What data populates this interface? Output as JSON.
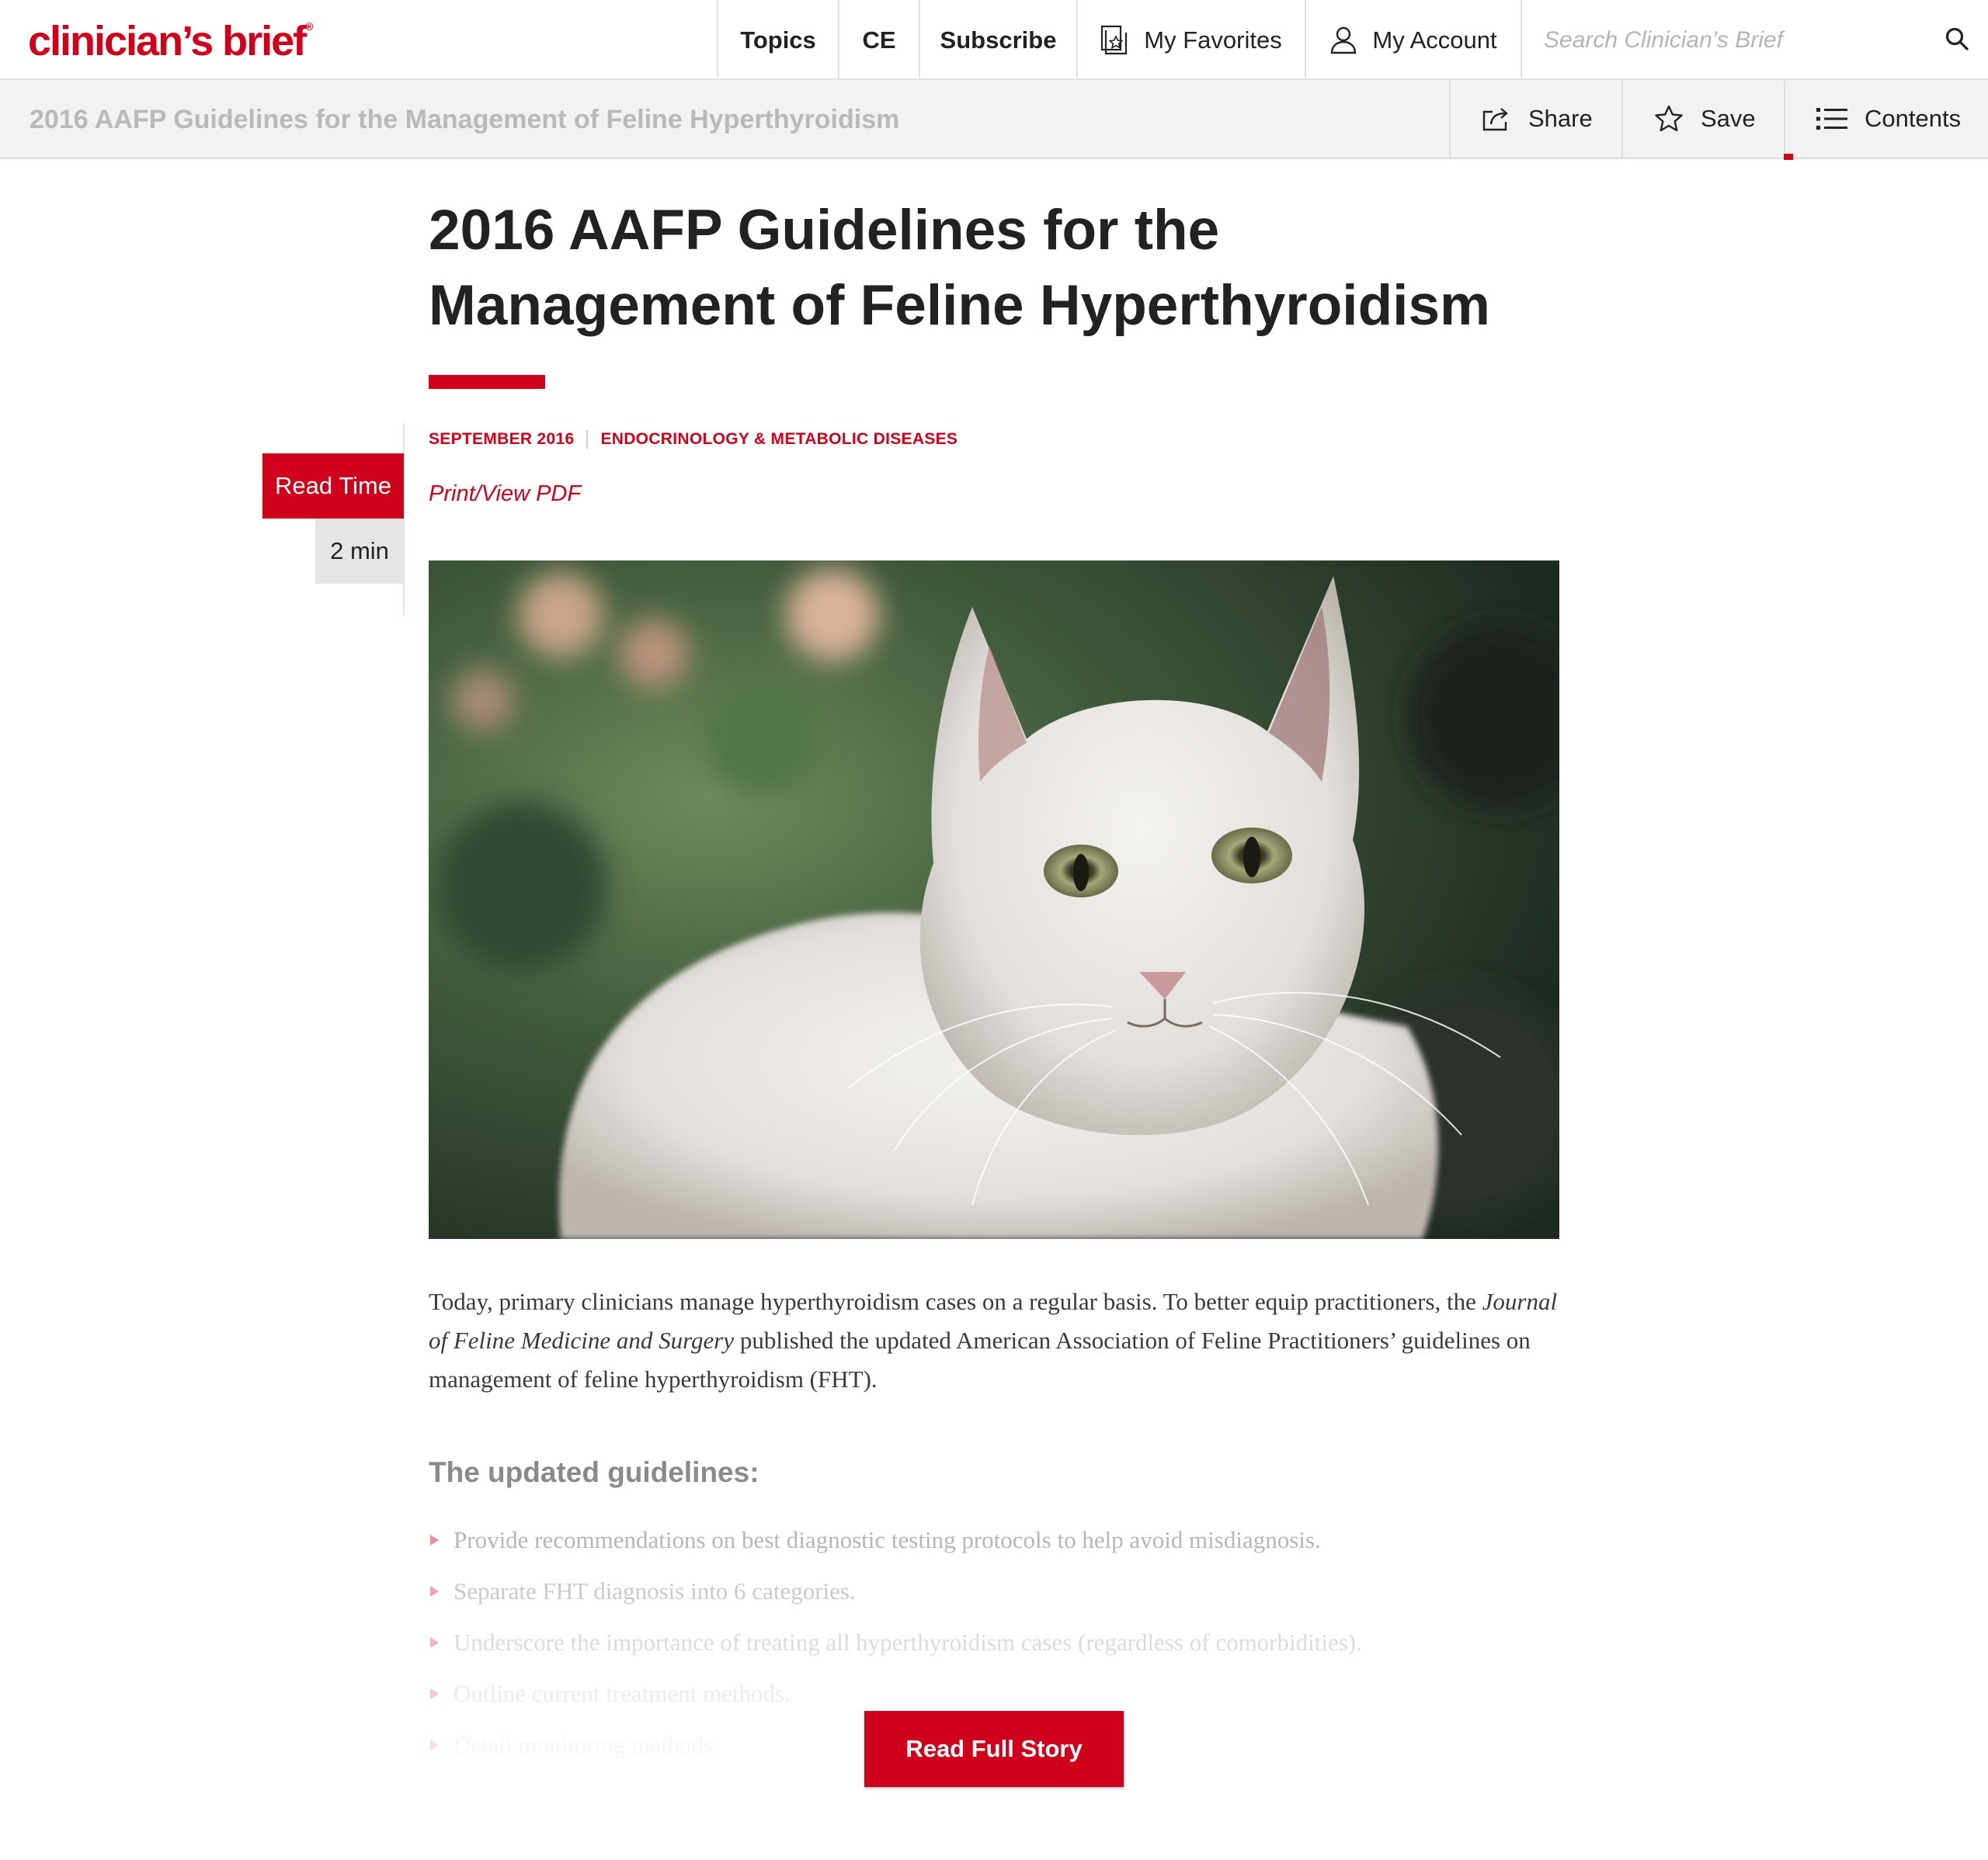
{
  "brand": {
    "logo_text": "clinician’s brief",
    "logo_mark": "®",
    "accent_color": "#d0021b"
  },
  "nav": {
    "topics": "Topics",
    "ce": "CE",
    "subscribe": "Subscribe",
    "favorites": "My Favorites",
    "account": "My Account",
    "search_placeholder": "Search Clinician’s Brief"
  },
  "article_bar": {
    "title": "2016 AAFP Guidelines for the Management of Feline Hyperthyroidism",
    "share": "Share",
    "save": "Save",
    "contents": "Contents"
  },
  "article": {
    "title_line1": "2016 AAFP Guidelines for the",
    "title_line2": "Management of Feline Hyperthyroidism",
    "date": "SEPTEMBER 2016",
    "category": "ENDOCRINOLOGY & METABOLIC DISEASES",
    "pdf_link": "Print/View PDF",
    "read_time_label": "Read Time",
    "read_time_value": "2 min",
    "intro_part1": "Today, primary clinicians manage hyperthyroidism cases on a regular basis. To better equip practitioners, the ",
    "intro_journal": "Journal of Feline Medicine and Surgery",
    "intro_part2": " published the updated American Association of Feline Practitioners’ guidelines on management of feline hyperthyroidism (FHT).",
    "section_heading": "The updated guidelines:",
    "bullets": [
      "Provide recommendations on best diagnostic testing protocols to help avoid misdiagnosis.",
      "Separate FHT diagnosis into 6 categories.",
      "Underscore the importance of treating all hyperthyroidism cases (regardless of comorbidities).",
      "Outline current treatment methods.",
      "Detail monitoring methods."
    ],
    "read_full_button": "Read Full Story"
  }
}
